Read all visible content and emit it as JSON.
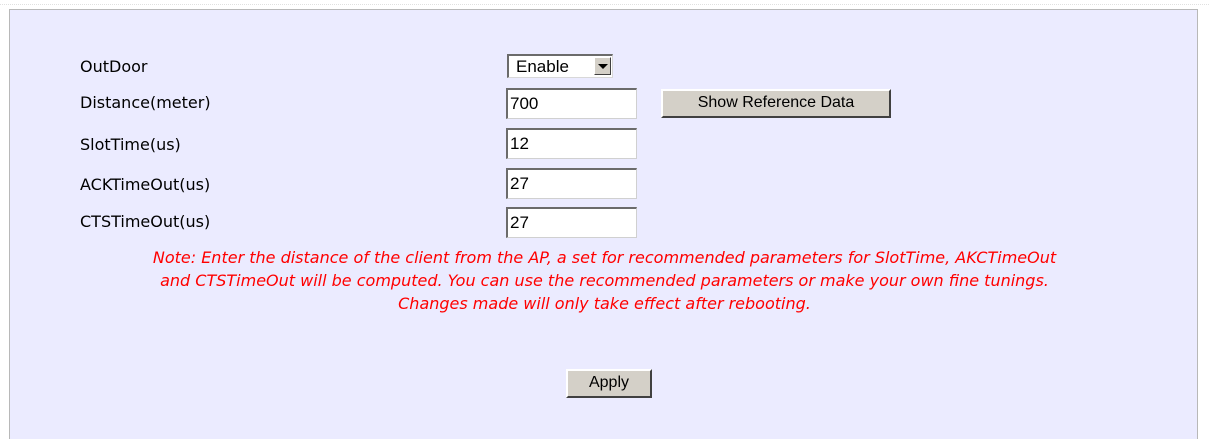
{
  "form": {
    "outdoor": {
      "label": "OutDoor",
      "selected": "Enable"
    },
    "distance": {
      "label": "Distance(meter)",
      "value": "700"
    },
    "slot_time": {
      "label": "SlotTime(us)",
      "value": "12"
    },
    "ack_timeout": {
      "label": "ACKTimeOut(us)",
      "value": "27"
    },
    "cts_timeout": {
      "label": "CTSTimeOut(us)",
      "value": "27"
    },
    "show_reference_label": "Show Reference Data"
  },
  "note": {
    "line1": "Note: Enter the distance of the client from the AP, a set for recommended parameters for SlotTime, AKCTimeOut",
    "line2": "and CTSTimeOut will be computed. You can use the recommended parameters or make your own fine tunings.",
    "line3": "Changes made will only take effect after rebooting."
  },
  "actions": {
    "apply_label": "Apply"
  },
  "colors": {
    "panel_background": "#ebebff",
    "note_text": "#ff0000",
    "button_face": "#d4d0c8"
  },
  "icons": {
    "select_arrow": "chevron-down-icon"
  }
}
